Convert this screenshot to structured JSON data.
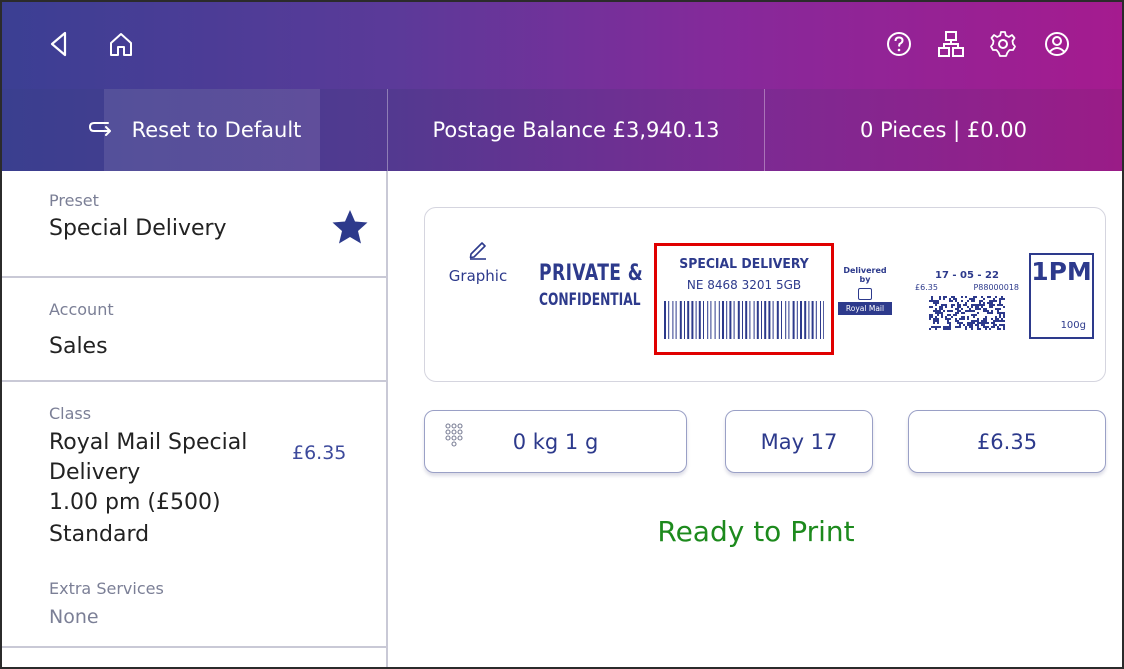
{
  "topbar": {
    "icons": [
      "back-icon",
      "home-icon",
      "help-icon",
      "network-icon",
      "settings-icon",
      "account-icon"
    ]
  },
  "infobar": {
    "reset_label": "Reset to Default",
    "balance_label": "Postage Balance £3,940.13",
    "pieces_label": "0 Pieces | £0.00"
  },
  "sidebar": {
    "preset": {
      "label": "Preset",
      "value": "Special Delivery",
      "favorite": true
    },
    "account": {
      "label": "Account",
      "value": "Sales"
    },
    "class": {
      "label": "Class",
      "lines": [
        "Royal Mail Special",
        "Delivery",
        "1.00 pm (£500)",
        "Standard"
      ],
      "price": "£6.35"
    },
    "extra_services": {
      "label": "Extra Services",
      "value": "None"
    }
  },
  "label_preview": {
    "graphic_label": "Graphic",
    "private_line1": "PRIVATE &",
    "private_line2": "CONFIDENTIAL",
    "special_delivery_title": "SPECIAL DELIVERY",
    "tracking_number": "NE 8468 3201 5GB",
    "delivered_by": "Delivered by",
    "royal_mail": "Royal Mail",
    "date": "17 - 05 - 22",
    "postage_amount": "£6.35",
    "meter_id": "P88000018",
    "service_time": "1PM",
    "weight_limit": "100g"
  },
  "controls": {
    "weight": "0 kg 1 g",
    "date": "May 17",
    "price": "£6.35"
  },
  "status": {
    "text": "Ready to Print",
    "color": "#1d8a1d"
  },
  "colors": {
    "accent": "#2d3a8c",
    "highlight_box": "#e00000",
    "gradient_start": "#3b3f93",
    "gradient_end": "#a51b8f"
  }
}
